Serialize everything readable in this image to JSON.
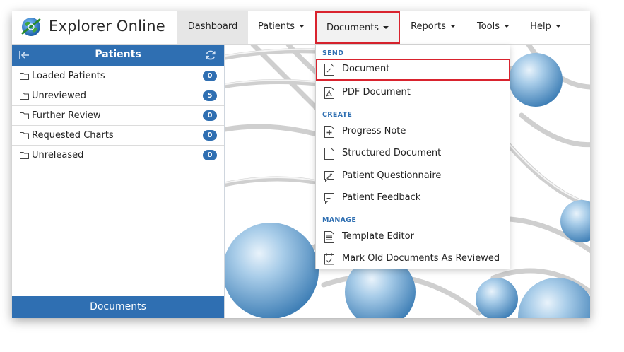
{
  "app": {
    "title": "Explorer Online"
  },
  "nav": {
    "dashboard": "Dashboard",
    "patients": "Patients",
    "documents": "Documents",
    "reports": "Reports",
    "tools": "Tools",
    "help": "Help"
  },
  "left_panel": {
    "title": "Patients",
    "footer": "Documents",
    "folders": [
      {
        "label": "Loaded Patients",
        "count": "0"
      },
      {
        "label": "Unreviewed",
        "count": "5"
      },
      {
        "label": "Further Review",
        "count": "0"
      },
      {
        "label": "Requested Charts",
        "count": "0"
      },
      {
        "label": "Unreleased",
        "count": "0"
      }
    ]
  },
  "dropdown": {
    "send_header": "SEND",
    "create_header": "CREATE",
    "manage_header": "MANAGE",
    "items": {
      "document": "Document",
      "pdf_document": "PDF Document",
      "progress_note": "Progress Note",
      "structured_document": "Structured Document",
      "patient_questionnaire": "Patient Questionnaire",
      "patient_feedback": "Patient Feedback",
      "template_editor": "Template Editor",
      "mark_old_documents": "Mark Old Documents As Reviewed"
    }
  },
  "colors": {
    "accent": "#2f6fb2",
    "highlight": "#d9232e"
  }
}
